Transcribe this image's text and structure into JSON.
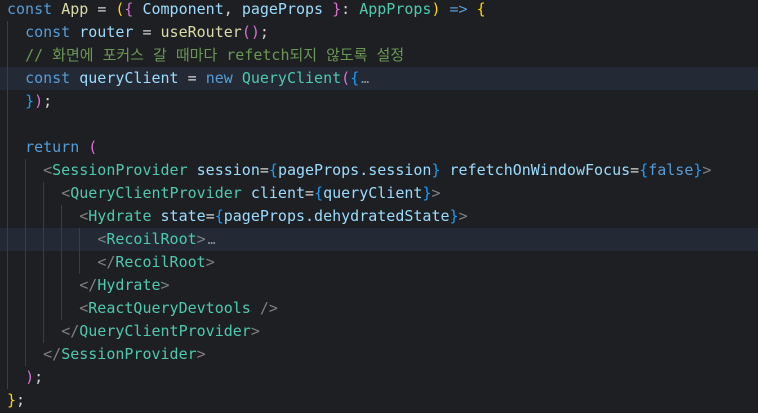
{
  "code_lines": [
    "const App = ({ Component, pageProps }: AppProps) => {",
    "  const router = useRouter();",
    "  // 화면에 포커스 갈 때마다 refetch되지 않도록 설정",
    "  const queryClient = new QueryClient({…",
    "  });",
    "",
    "  return (",
    "    <SessionProvider session={pageProps.session} refetchOnWindowFocus={false}>",
    "      <QueryClientProvider client={queryClient}>",
    "        <Hydrate state={pageProps.dehydratedState}>",
    "          <RecoilRoot>…",
    "          </RecoilRoot>",
    "        </Hydrate>",
    "        <ReactQueryDevtools />",
    "      </QueryClientProvider>",
    "    </SessionProvider>",
    "  );",
    "};"
  ],
  "tokens": {
    "const": "const",
    "app": "App",
    "eq": "=",
    "component": "Component",
    "pageProps": "pageProps",
    "appProps": "AppProps",
    "arrow": "=>",
    "router": "router",
    "useRouter": "useRouter",
    "comment": "// 화면에 포커스 갈 때마다 refetch되지 않도록 설정",
    "queryClientVar": "queryClient",
    "new": "new",
    "QueryClient": "QueryClient",
    "ellipsis": "…",
    "return": "return",
    "SessionProvider": "SessionProvider",
    "session": "session",
    "pagePropsSession": "pageProps.session",
    "refetchOnWindowFocus": "refetchOnWindowFocus",
    "false": "false",
    "QueryClientProvider": "QueryClientProvider",
    "client": "client",
    "Hydrate": "Hydrate",
    "state": "state",
    "dehydratedState": "pageProps.dehydratedState",
    "RecoilRoot": "RecoilRoot",
    "ReactQueryDevtools": "ReactQueryDevtools"
  },
  "highlighted_lines": [
    4,
    11
  ],
  "colors": {
    "background": "#1e1f22",
    "line_highlight": "#232a35",
    "keyword": "#569cd6",
    "function": "#dcdcaa",
    "component": "#4ec9b0",
    "variable": "#9cdcfe",
    "comment": "#6a9955",
    "bracket_level_1": "#ffd700",
    "bracket_level_2": "#da70d6",
    "bracket_level_3": "#179fff",
    "tag_bracket": "#808080"
  },
  "icons": {
    "fold": "ellipsis-fold-icon"
  }
}
